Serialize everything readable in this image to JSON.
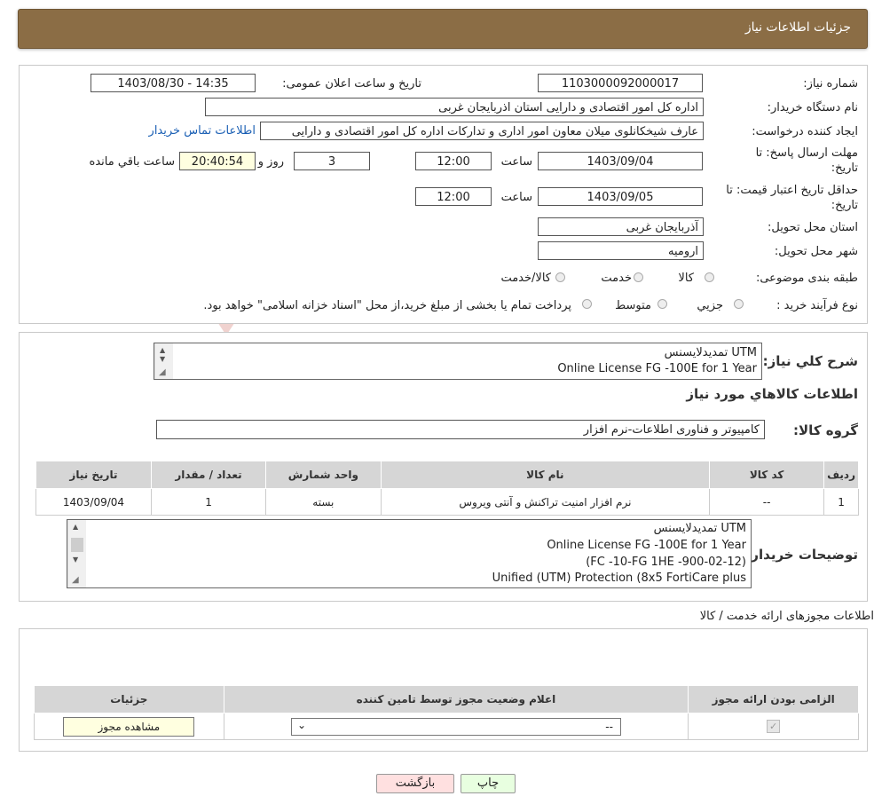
{
  "header": {
    "title": "جزئیات اطلاعات نیاز"
  },
  "info": {
    "need_number_label": "شماره نیاز:",
    "need_number": "1103000092000017",
    "announce_label": "تاریخ و ساعت اعلان عمومی:",
    "announce_value": "1403/08/30 - 14:35",
    "buyer_org_label": "نام دستگاه خریدار:",
    "buyer_org": "اداره کل امور اقتصادی و دارایی استان اذربایجان غربی",
    "creator_label": "ایجاد کننده درخواست:",
    "creator": "عارف شیخکانلوی میلان معاون امور اداری و تدارکات اداره کل امور اقتصادی و دارایی",
    "contact_link": "اطلاعات تماس خریدار",
    "deadline_label_1": "مهلت ارسال پاسخ: تا",
    "deadline_label_2": "تاریخ:",
    "deadline_date": "1403/09/04",
    "time_label": "ساعت",
    "deadline_time": "12:00",
    "days": "3",
    "days_label": "روز و",
    "remaining": "20:40:54",
    "remaining_label": "ساعت باقي مانده",
    "validity_label_1": "حداقل تاریخ اعتبار قیمت: تا",
    "validity_label_2": "تاریخ:",
    "validity_date": "1403/09/05",
    "validity_time": "12:00",
    "province_label": "استان محل تحویل:",
    "province": "آذربایجان غربی",
    "city_label": "شهر محل تحویل:",
    "city": "ارومیه",
    "category_label": "طبقه بندی موضوعی:",
    "category_options": [
      "کالا",
      "خدمت",
      "کالا/خدمت"
    ],
    "process_label": "نوع فرآیند خرید :",
    "process_options": [
      "جزیي",
      "متوسط"
    ],
    "process_note": "پرداخت تمام یا بخشی از مبلغ خرید،از محل \"اسناد خزانه اسلامی\" خواهد بود."
  },
  "summary": {
    "label": "شرح کلي نياز:",
    "lines": [
      "تمدیدلایسنس   UTM",
      "Online License FG -100E for 1 Year"
    ],
    "goods_title": "اطلاعات کالاهاي مورد نياز",
    "group_label": "گروه کالا:",
    "group_value": "کامپیوتر و فناوری اطلاعات-نرم افزار"
  },
  "goods_table": {
    "headers": [
      "رديف",
      "کد کالا",
      "نام کالا",
      "واحد شمارش",
      "تعداد / مقدار",
      "تاريخ نياز"
    ],
    "row": [
      "1",
      "--",
      "نرم افزار امنیت تراکنش و آنتی ویروس",
      "بسته",
      "1",
      "1403/09/04"
    ]
  },
  "buyer_notes": {
    "label": "توضیحات خریدار:",
    "lines": [
      "تمدیدلایسنس   UTM",
      "Online License FG -100E for 1 Year",
      "(FC -10-FG 1HE -900-02-12)",
      "Unified (UTM) Protection (8x5 FortiCare plus"
    ]
  },
  "licenses": {
    "title": "اطلاعات مجوزهای ارائه خدمت / کالا",
    "headers": [
      "الزامی بودن ارائه مجوز",
      "اعلام وضعیت مجوز توسط تامین کننده",
      "جزئیات"
    ],
    "select_value": "--",
    "view_button": "مشاهده مجوز"
  },
  "buttons": {
    "print": "چاپ",
    "back": "بازگشت"
  }
}
